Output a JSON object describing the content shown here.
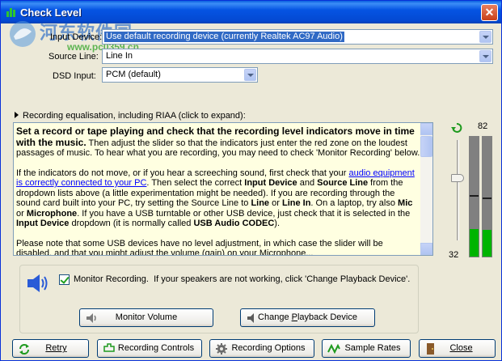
{
  "window": {
    "title": "Check Level",
    "close_glyph": "✕"
  },
  "watermark": {
    "text": "河东软件园",
    "url": "www.pc0359.cn"
  },
  "fields": {
    "input_device_label": "Input Device:",
    "input_device_value": "Use default recording device (currently Realtek AC97 Audio)",
    "source_line_label": "Source Line:",
    "source_line_value": "Line In",
    "dsd_input_label": "DSD Input:",
    "dsd_input_value": "PCM (default)"
  },
  "expander": {
    "label": "Recording equalisation, including RIAA (click to expand):"
  },
  "help": {
    "lead": "Set a record or tape playing and check that the recording level indicators move in time with the music.",
    "p1_rest": "Then adjust the slider so that the indicators just enter the red zone on the loudest passages of music.  To hear what you are recording, you may need to check 'Monitor Recording' below.",
    "p2_a": "If the indicators do not move, or if you hear a screeching sound, first check that your ",
    "p2_link": "audio equipment is correctly connected to your PC",
    "p2_b": ".  Then select the correct ",
    "p2_input_device": "Input Device",
    "p2_c": " and ",
    "p2_source_line": "Source Line",
    "p2_d": " from the dropdown lists above (a little experimentation might be needed).  If you are recording through the sound card built into your PC, try setting the Source Line to ",
    "p2_line": "Line",
    "p2_e": " or ",
    "p2_line_in": "Line In",
    "p2_f": ".  On a laptop, try also ",
    "p2_mic": "Mic",
    "p2_g": " or ",
    "p2_microphone": "Microphone",
    "p2_h": ".  If you have a USB turntable or other USB device, just check that it is selected in the ",
    "p2_input_device2": "Input Device",
    "p2_i": " dropdown (it is normally called ",
    "p2_usb": "USB Audio CODEC",
    "p2_j": ").",
    "p3": "Please note that some USB devices have no level adjustment, in which case the slider will be disabled, and that you might adjust the volume (gain) on your Microphone..."
  },
  "meter": {
    "top_value": "82",
    "bottom_value": "32",
    "slider_level": 0.62,
    "left_level": 0.23,
    "right_level": 0.22,
    "left_peak": 0.5,
    "right_peak": 0.48
  },
  "monitor": {
    "checkbox_label": "Monitor Recording.",
    "hint": "If your speakers are not working, click 'Change Playback Device'.",
    "checked": true,
    "volume_button": "Monitor Volume",
    "playback_button_a": "Change ",
    "playback_button_u": "P",
    "playback_button_b": "layback Device"
  },
  "bottom_buttons": {
    "retry": "Retry",
    "recording_controls": "Recording Controls",
    "recording_options": "Recording Options",
    "sample_rates": "Sample Rates",
    "close": "Close"
  },
  "colors": {
    "accent": "#316AC5",
    "meter_green": "#00B400",
    "panel_bg": "#FFFFE1"
  }
}
